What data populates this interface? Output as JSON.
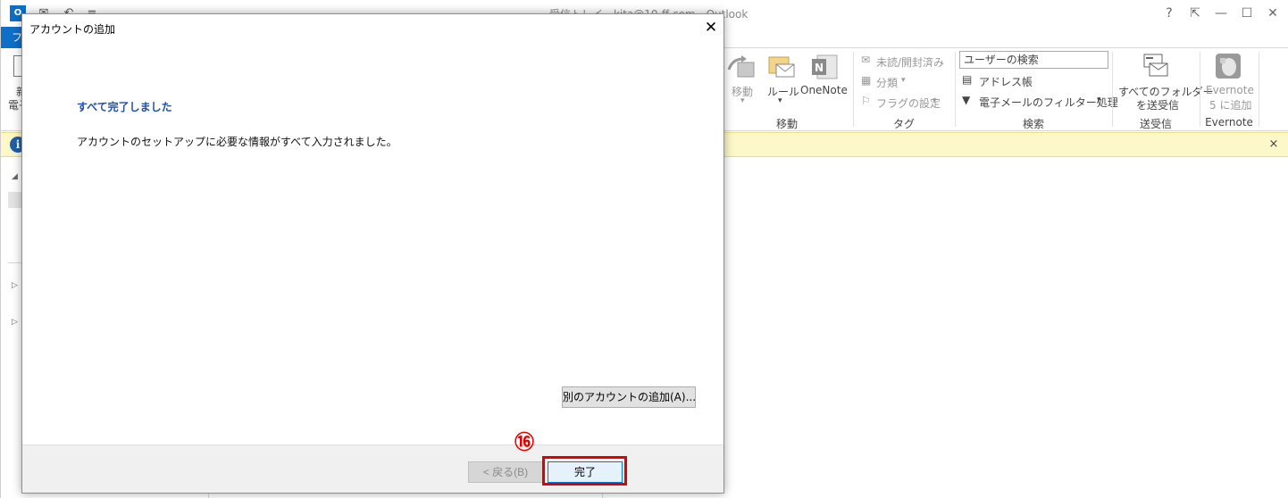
{
  "outlook": {
    "window_title": "受信トレイ - kita@10-ff.com - Outlook",
    "app_logo": "O",
    "window_controls": [
      "?",
      "⇱",
      "—",
      "☐",
      "✕"
    ],
    "file_tab": "ファ",
    "ribbon": {
      "new_email_label_1": "新",
      "new_email_label_2": "電子",
      "move": {
        "move_label": "移動",
        "rules_label": "ルール",
        "onenote_label": "OneNote",
        "group_label": "移動"
      },
      "tags": {
        "unread_label": "未読/開封済み",
        "categorize_label": "分類",
        "followup_label": "フラグの設定",
        "group_label": "タグ"
      },
      "search": {
        "search_people_placeholder": "ユーザーの検索",
        "address_book_label": "アドレス帳",
        "filter_email_label": "電子メールのフィルター処理",
        "group_label": "検索"
      },
      "send_receive": {
        "send_all_label_1": "すべてのフォルダー",
        "send_all_label_2": "を送受信",
        "group_label": "送受信"
      },
      "evernote": {
        "add_label_1": "Evernote",
        "add_label_2": "5 に追加",
        "group_label": "Evernote"
      }
    },
    "info_icon": "i",
    "info_close": "×"
  },
  "dialog": {
    "title": "アカウントの追加",
    "close_glyph": "✕",
    "heading": "すべて完了しました",
    "message": "アカウントのセットアップに必要な情報がすべて入力されました。",
    "add_another_label": "別のアカウントの追加(A)...",
    "back_label": "< 戻る(B)",
    "finish_label": "完了"
  },
  "annotation": {
    "step_marker": "⑯",
    "highlight_color": "#e00000"
  },
  "colors": {
    "accent": "#0f6fc6",
    "dialog_heading": "#1f4fa0",
    "infobar": "#fdf8c9"
  }
}
